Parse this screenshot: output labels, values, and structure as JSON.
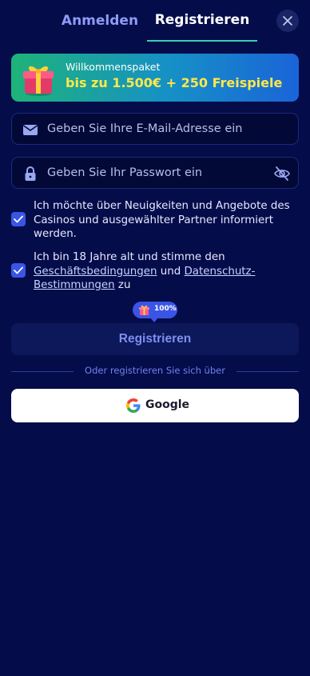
{
  "tabs": {
    "login": "Anmelden",
    "register": "Registrieren"
  },
  "banner": {
    "kicker": "Willkommenspaket",
    "headline": "bis zu 1.500€ + 250 Freispiele"
  },
  "form": {
    "email_placeholder": "Geben Sie Ihre E-Mail-Adresse ein",
    "email_value": "",
    "password_placeholder": "Geben Sie Ihr Passwort ein",
    "password_value": ""
  },
  "consents": {
    "newsletter": {
      "checked": true,
      "text": "Ich möchte über Neuigkeiten und Angebote des Casinos und ausgewählter Partner informiert werden."
    },
    "terms": {
      "checked": true,
      "text_before": "Ich bin 18 Jahre alt und stimme den ",
      "terms_link": "Geschäftsbedingungen",
      "text_middle": " und ",
      "privacy_link": "Datenschutz-Bestimmungen",
      "text_after": " zu"
    }
  },
  "progress_badge": {
    "label": "100%"
  },
  "submit_label": "Registrieren",
  "divider_text": "Oder registrieren Sie sich über",
  "google_label": "Google",
  "colors": {
    "background": "#050c4a",
    "accent": "#3a55e6",
    "tab_underline": "#37d0b4",
    "banner_highlight": "#ffe84a"
  },
  "icons": {
    "close": "close-icon",
    "gift": "gift-icon",
    "email": "envelope-icon",
    "password": "lock-icon",
    "toggle_password": "eye-off-icon",
    "checkbox": "checkmark-icon",
    "google": "google-logo-icon"
  }
}
